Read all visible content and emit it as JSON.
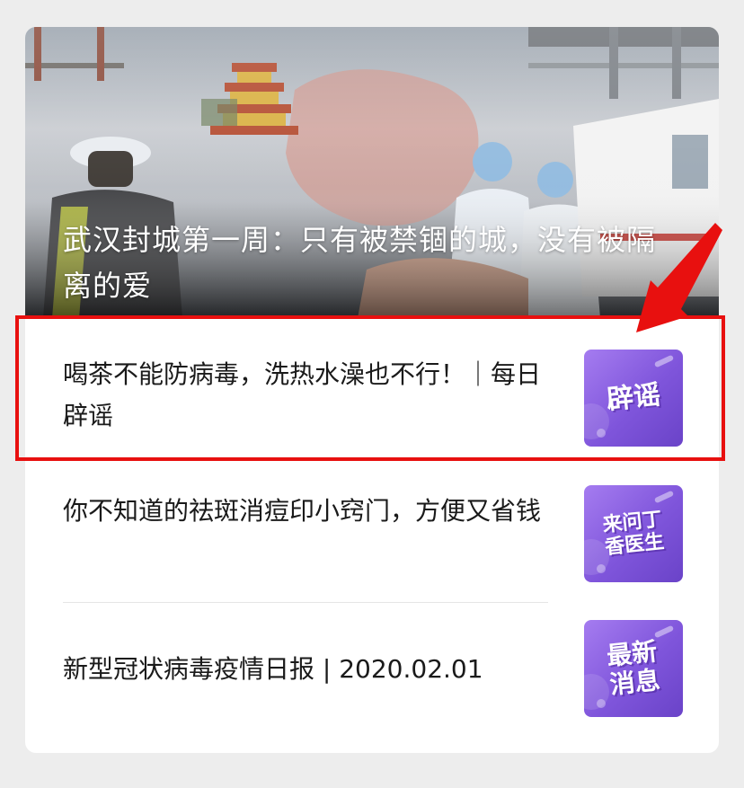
{
  "hero": {
    "title": "武汉封城第一周：只有被禁锢的城，没有被隔离的爱"
  },
  "articles": [
    {
      "title": "喝茶不能防病毒，洗热水澡也不行！｜每日辟谣",
      "badge": "辟谣"
    },
    {
      "title": "你不知道的祛斑消痘印小窍门，方便又省钱",
      "badge": "来问丁香医生"
    },
    {
      "title": "新型冠状病毒疫情日报 | 2020.02.01",
      "badge": "最新消息"
    }
  ],
  "colors": {
    "highlight": "#e8100f",
    "badge_purple": "#7f55db"
  }
}
